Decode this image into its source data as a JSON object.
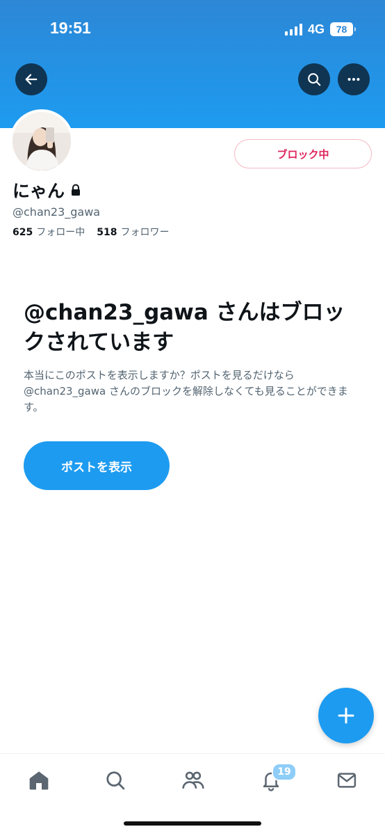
{
  "status_bar": {
    "time": "19:51",
    "network": "4G",
    "battery": "78"
  },
  "icons": {
    "back": "arrow-left-icon",
    "search": "search-icon",
    "more": "more-horizontal-icon",
    "lock": "lock-icon",
    "compose": "plus-icon"
  },
  "profile": {
    "name": "にゃん",
    "handle": "@chan23_gawa",
    "following_count": "625",
    "following_label": "フォロー中",
    "followers_count": "518",
    "followers_label": "フォロワー",
    "block_button": "ブロック中"
  },
  "blocked_notice": {
    "title": "@chan23_gawa さんはブロックされています",
    "description": "本当にこのポストを表示しますか？ポストを見るだけなら@chan23_gawa さんのブロックを解除しなくても見ることができます。",
    "view_button": "ポストを表示"
  },
  "tab_bar": {
    "items": [
      "home-icon",
      "search-icon",
      "communities-icon",
      "notifications-icon",
      "messages-icon"
    ],
    "notifications_badge": "19"
  },
  "colors": {
    "accent": "#1d9bf0",
    "header": "#2d87d6",
    "block_red": "#e0245e",
    "secondary_text": "#536471"
  }
}
